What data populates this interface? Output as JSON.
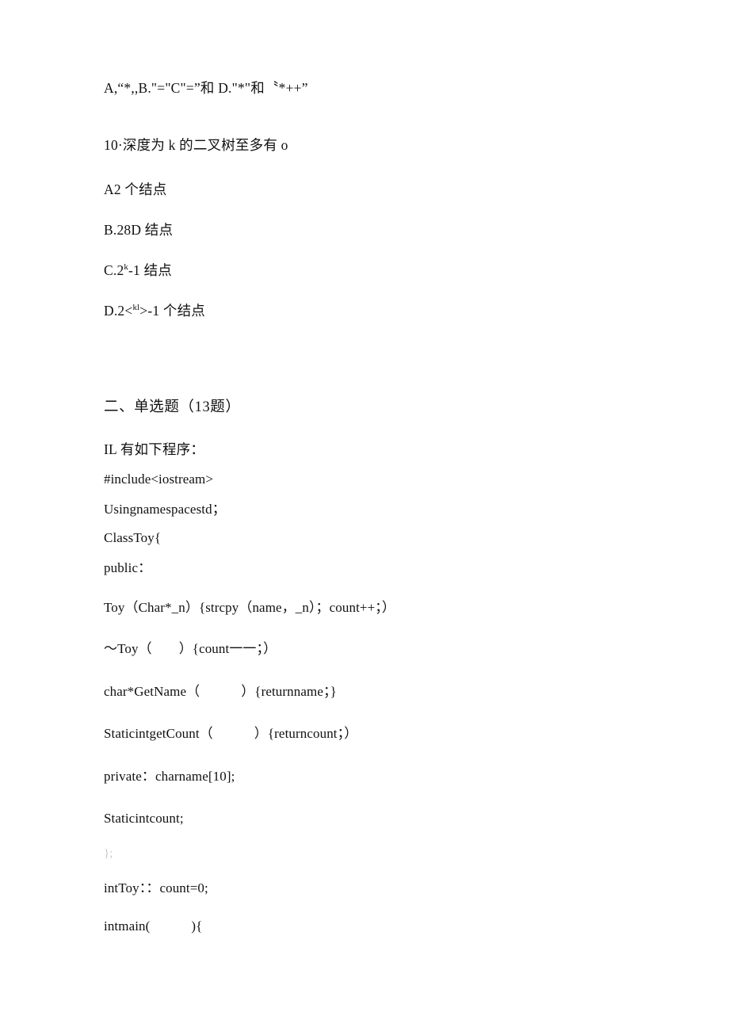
{
  "document": {
    "page_background": "#ffffff",
    "text_color": "#111111",
    "faint_color": "#c9c9c9"
  },
  "answers_row": {
    "text": "A,“*,,B.\"=\"C\"=”和 D.\"*\"和〝*++”"
  },
  "question_10": {
    "stem": "10·深度为 k 的二叉树至多有 o",
    "options": [
      {
        "label": "A2 个结点"
      },
      {
        "label": "B.28D 结点"
      },
      {
        "prefix": "C.2",
        "sup": "k",
        "suffix": "-1 结点"
      },
      {
        "prefix": "D.2<",
        "sup": "kl",
        "suffix": ">-1 个结点"
      }
    ]
  },
  "section_two": {
    "heading": "二、单选题（13题）"
  },
  "question_11": {
    "stem": "IL 有如下程序：",
    "code": [
      {
        "text": "#include<iostream>"
      },
      {
        "text": "Usingnamespacestd；"
      },
      {
        "text": "ClassToy{"
      },
      {
        "text": "public："
      },
      {
        "text": "Toy（Char*_n）{strcpy（name，_n）；count++；）"
      },
      {
        "text": "～Toy（",
        "gap": "wide",
        "text2": "）{count一一；）"
      },
      {
        "text": "char*GetName（",
        "gap": "mid",
        "text2": "）{returnname；}"
      },
      {
        "text": "StaticintgetCount（",
        "gap": "mid",
        "text2": "）{returncount；）"
      },
      {
        "text": "private：charname[10];"
      },
      {
        "text": "Staticintcount;"
      },
      {
        "text": "};",
        "faint": true
      },
      {
        "text": "intToy：：count=0;"
      },
      {
        "text": "intmain(",
        "gap": "mid",
        "text2": "){"
      }
    ]
  }
}
